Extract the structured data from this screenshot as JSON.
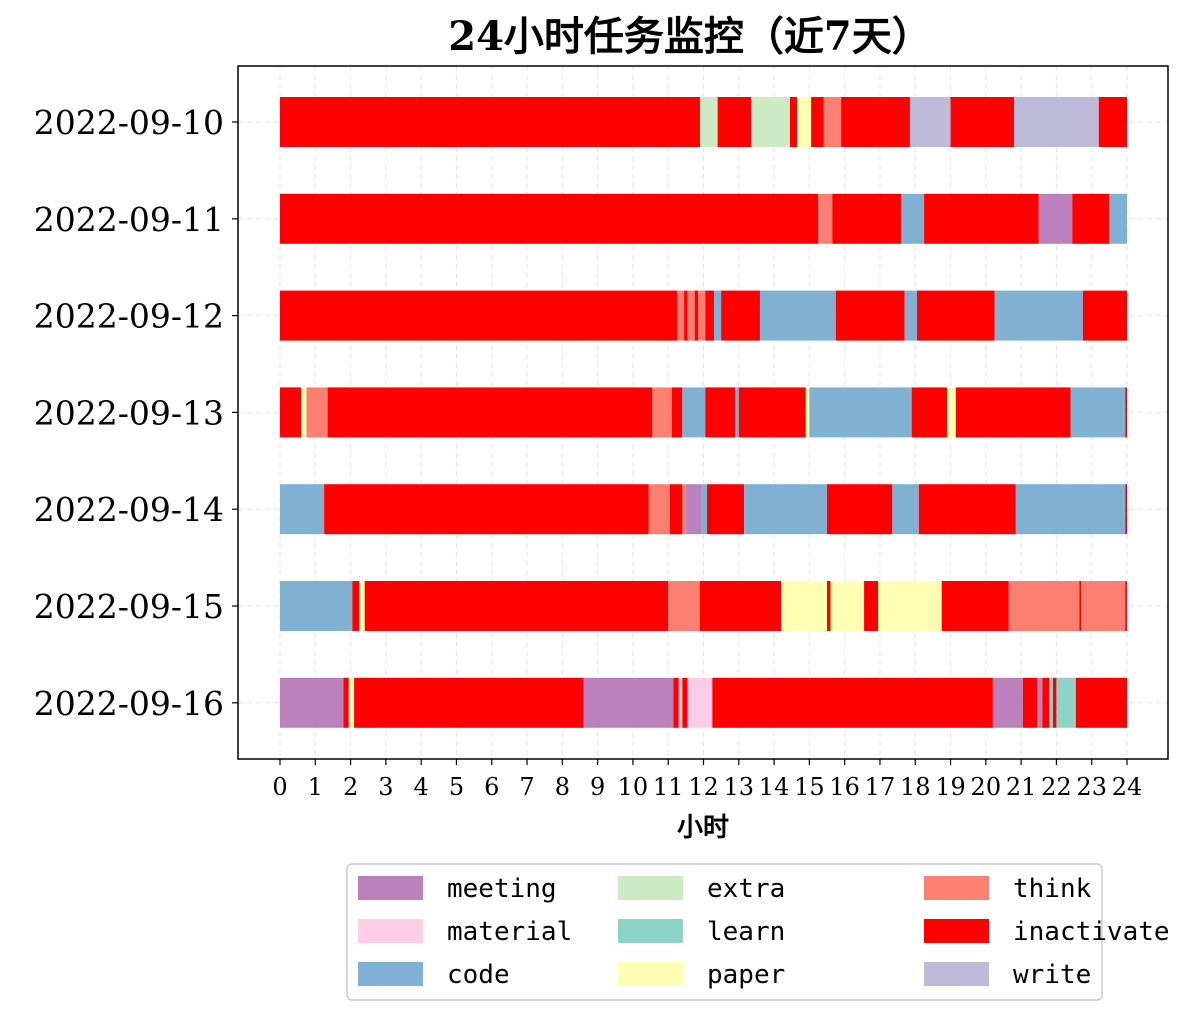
{
  "chart_data": {
    "type": "bar",
    "orientation": "horizontal-stacked-timeline",
    "title": "24小时任务监控（近7天）",
    "xlabel": "小时",
    "ylabel": "",
    "xlim": [
      0,
      24
    ],
    "xticks": [
      0,
      1,
      2,
      3,
      4,
      5,
      6,
      7,
      8,
      9,
      10,
      11,
      12,
      13,
      14,
      15,
      16,
      17,
      18,
      19,
      20,
      21,
      22,
      23,
      24
    ],
    "grid": true,
    "legend_position": "bottom",
    "categories": [
      "2022-09-10",
      "2022-09-11",
      "2022-09-12",
      "2022-09-13",
      "2022-09-14",
      "2022-09-15",
      "2022-09-16"
    ],
    "legend": [
      {
        "name": "meeting",
        "color": "#bc80bd"
      },
      {
        "name": "material",
        "color": "#fccde5"
      },
      {
        "name": "code",
        "color": "#80b1d3"
      },
      {
        "name": "extra",
        "color": "#ccebc5"
      },
      {
        "name": "learn",
        "color": "#8dd3c7"
      },
      {
        "name": "paper",
        "color": "#ffffb3"
      },
      {
        "name": "think",
        "color": "#fb8072"
      },
      {
        "name": "inactivate",
        "color": "#ff0000"
      },
      {
        "name": "write",
        "color": "#bebada"
      }
    ],
    "rows": [
      {
        "date": "2022-09-10",
        "segments": [
          {
            "task": "inactivate",
            "start": 0,
            "end": 11.9
          },
          {
            "task": "extra",
            "start": 11.9,
            "end": 12.4
          },
          {
            "task": "inactivate",
            "start": 12.4,
            "end": 13.35
          },
          {
            "task": "extra",
            "start": 13.35,
            "end": 14.45
          },
          {
            "task": "inactivate",
            "start": 14.45,
            "end": 14.65
          },
          {
            "task": "paper",
            "start": 14.65,
            "end": 15.05
          },
          {
            "task": "inactivate",
            "start": 15.05,
            "end": 15.4
          },
          {
            "task": "think",
            "start": 15.4,
            "end": 15.9
          },
          {
            "task": "inactivate",
            "start": 15.9,
            "end": 17.85
          },
          {
            "task": "write",
            "start": 17.85,
            "end": 19.0
          },
          {
            "task": "inactivate",
            "start": 19.0,
            "end": 20.8
          },
          {
            "task": "write",
            "start": 20.8,
            "end": 23.2
          },
          {
            "task": "inactivate",
            "start": 23.2,
            "end": 24
          }
        ]
      },
      {
        "date": "2022-09-11",
        "segments": [
          {
            "task": "inactivate",
            "start": 0,
            "end": 15.25
          },
          {
            "task": "think",
            "start": 15.25,
            "end": 15.65
          },
          {
            "task": "inactivate",
            "start": 15.65,
            "end": 17.6
          },
          {
            "task": "code",
            "start": 17.6,
            "end": 18.25
          },
          {
            "task": "inactivate",
            "start": 18.25,
            "end": 21.5
          },
          {
            "task": "meeting",
            "start": 21.5,
            "end": 22.45
          },
          {
            "task": "inactivate",
            "start": 22.45,
            "end": 23.5
          },
          {
            "task": "code",
            "start": 23.5,
            "end": 24
          }
        ]
      },
      {
        "date": "2022-09-12",
        "segments": [
          {
            "task": "inactivate",
            "start": 0,
            "end": 11.25
          },
          {
            "task": "think",
            "start": 11.25,
            "end": 11.45
          },
          {
            "task": "inactivate",
            "start": 11.45,
            "end": 11.55
          },
          {
            "task": "think",
            "start": 11.55,
            "end": 11.75
          },
          {
            "task": "inactivate",
            "start": 11.75,
            "end": 11.85
          },
          {
            "task": "think",
            "start": 11.85,
            "end": 12.05
          },
          {
            "task": "inactivate",
            "start": 12.05,
            "end": 12.3
          },
          {
            "task": "code",
            "start": 12.3,
            "end": 12.5
          },
          {
            "task": "inactivate",
            "start": 12.5,
            "end": 13.6
          },
          {
            "task": "code",
            "start": 13.6,
            "end": 15.75
          },
          {
            "task": "inactivate",
            "start": 15.75,
            "end": 17.7
          },
          {
            "task": "code",
            "start": 17.7,
            "end": 18.05
          },
          {
            "task": "inactivate",
            "start": 18.05,
            "end": 20.25
          },
          {
            "task": "code",
            "start": 20.25,
            "end": 22.75
          },
          {
            "task": "inactivate",
            "start": 22.75,
            "end": 24
          }
        ]
      },
      {
        "date": "2022-09-13",
        "segments": [
          {
            "task": "inactivate",
            "start": 0,
            "end": 0.6
          },
          {
            "task": "paper",
            "start": 0.6,
            "end": 0.75
          },
          {
            "task": "think",
            "start": 0.75,
            "end": 1.35
          },
          {
            "task": "inactivate",
            "start": 1.35,
            "end": 10.55
          },
          {
            "task": "think",
            "start": 10.55,
            "end": 11.1
          },
          {
            "task": "inactivate",
            "start": 11.1,
            "end": 11.4
          },
          {
            "task": "code",
            "start": 11.4,
            "end": 12.05
          },
          {
            "task": "inactivate",
            "start": 12.05,
            "end": 12.9
          },
          {
            "task": "code",
            "start": 12.9,
            "end": 13.0
          },
          {
            "task": "inactivate",
            "start": 13.0,
            "end": 14.9
          },
          {
            "task": "paper",
            "start": 14.9,
            "end": 15.0
          },
          {
            "task": "code",
            "start": 15.0,
            "end": 17.9
          },
          {
            "task": "inactivate",
            "start": 17.9,
            "end": 18.9
          },
          {
            "task": "paper",
            "start": 18.9,
            "end": 19.15
          },
          {
            "task": "inactivate",
            "start": 19.15,
            "end": 22.4
          },
          {
            "task": "code",
            "start": 22.4,
            "end": 23.95
          },
          {
            "task": "inactivate",
            "start": 23.95,
            "end": 24
          }
        ]
      },
      {
        "date": "2022-09-14",
        "segments": [
          {
            "task": "code",
            "start": 0,
            "end": 1.25
          },
          {
            "task": "inactivate",
            "start": 1.25,
            "end": 10.45
          },
          {
            "task": "think",
            "start": 10.45,
            "end": 11.05
          },
          {
            "task": "inactivate",
            "start": 11.05,
            "end": 11.4
          },
          {
            "task": "think",
            "start": 11.4,
            "end": 11.5
          },
          {
            "task": "meeting",
            "start": 11.5,
            "end": 11.95
          },
          {
            "task": "code",
            "start": 11.95,
            "end": 12.1
          },
          {
            "task": "inactivate",
            "start": 12.1,
            "end": 13.15
          },
          {
            "task": "code",
            "start": 13.15,
            "end": 15.5
          },
          {
            "task": "inactivate",
            "start": 15.5,
            "end": 17.35
          },
          {
            "task": "code",
            "start": 17.35,
            "end": 18.1
          },
          {
            "task": "inactivate",
            "start": 18.1,
            "end": 20.85
          },
          {
            "task": "code",
            "start": 20.85,
            "end": 23.95
          },
          {
            "task": "inactivate",
            "start": 23.95,
            "end": 24
          }
        ]
      },
      {
        "date": "2022-09-15",
        "segments": [
          {
            "task": "code",
            "start": 0,
            "end": 2.05
          },
          {
            "task": "inactivate",
            "start": 2.05,
            "end": 2.25
          },
          {
            "task": "paper",
            "start": 2.25,
            "end": 2.4
          },
          {
            "task": "inactivate",
            "start": 2.4,
            "end": 11.0
          },
          {
            "task": "think",
            "start": 11.0,
            "end": 11.9
          },
          {
            "task": "inactivate",
            "start": 11.9,
            "end": 14.2
          },
          {
            "task": "paper",
            "start": 14.2,
            "end": 15.5
          },
          {
            "task": "inactivate",
            "start": 15.5,
            "end": 15.6
          },
          {
            "task": "paper",
            "start": 15.6,
            "end": 16.55
          },
          {
            "task": "inactivate",
            "start": 16.55,
            "end": 16.95
          },
          {
            "task": "paper",
            "start": 16.95,
            "end": 18.75
          },
          {
            "task": "inactivate",
            "start": 18.75,
            "end": 20.65
          },
          {
            "task": "think",
            "start": 20.65,
            "end": 22.65
          },
          {
            "task": "inactivate",
            "start": 22.65,
            "end": 22.7
          },
          {
            "task": "think",
            "start": 22.7,
            "end": 23.95
          },
          {
            "task": "inactivate",
            "start": 23.95,
            "end": 24
          }
        ]
      },
      {
        "date": "2022-09-16",
        "segments": [
          {
            "task": "meeting",
            "start": 0,
            "end": 1.8
          },
          {
            "task": "inactivate",
            "start": 1.8,
            "end": 1.95
          },
          {
            "task": "paper",
            "start": 1.95,
            "end": 2.1
          },
          {
            "task": "inactivate",
            "start": 2.1,
            "end": 8.6
          },
          {
            "task": "meeting",
            "start": 8.6,
            "end": 11.15
          },
          {
            "task": "inactivate",
            "start": 11.15,
            "end": 11.3
          },
          {
            "task": "material",
            "start": 11.3,
            "end": 11.4
          },
          {
            "task": "inactivate",
            "start": 11.4,
            "end": 11.55
          },
          {
            "task": "material",
            "start": 11.55,
            "end": 12.25
          },
          {
            "task": "inactivate",
            "start": 12.25,
            "end": 20.2
          },
          {
            "task": "meeting",
            "start": 20.2,
            "end": 21.05
          },
          {
            "task": "inactivate",
            "start": 21.05,
            "end": 21.45
          },
          {
            "task": "meeting",
            "start": 21.45,
            "end": 21.6
          },
          {
            "task": "inactivate",
            "start": 21.6,
            "end": 21.8
          },
          {
            "task": "learn",
            "start": 21.8,
            "end": 21.9
          },
          {
            "task": "inactivate",
            "start": 21.9,
            "end": 22.0
          },
          {
            "task": "learn",
            "start": 22.0,
            "end": 22.55
          },
          {
            "task": "inactivate",
            "start": 22.55,
            "end": 24
          }
        ]
      }
    ]
  }
}
